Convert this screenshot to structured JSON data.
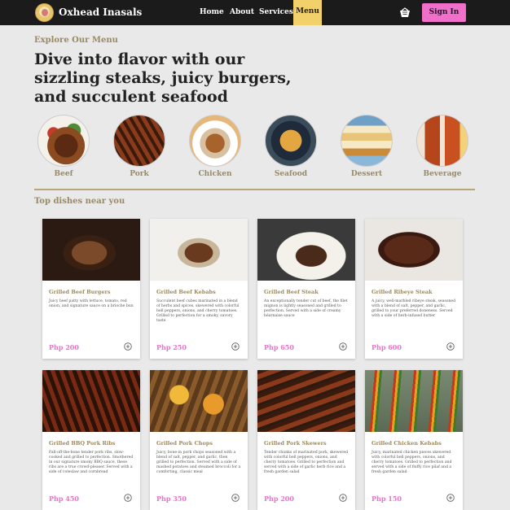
{
  "nav": {
    "brand": "Oxhead Inasals",
    "links": [
      "Home",
      "About",
      "Services",
      "Menu"
    ],
    "active": "Menu",
    "signin": "Sign In",
    "icons": [
      "logo",
      "basket-icon"
    ],
    "colors": {
      "bar": "#1b1b1b",
      "active": "#f2d16b",
      "signin": "#f06fc9"
    }
  },
  "hero": {
    "eyebrow": "Explore Our Menu",
    "headline": "Dive into flavor with our sizzling steaks, juicy burgers, and succulent seafood"
  },
  "categories": [
    {
      "label": "Beef"
    },
    {
      "label": "Pork"
    },
    {
      "label": "Chicken"
    },
    {
      "label": "Seafood"
    },
    {
      "label": "Dessert"
    },
    {
      "label": "Beverage"
    }
  ],
  "section": {
    "title": "Top dishes near you"
  },
  "dishes": [
    {
      "title": "Grilled Beef Burgers",
      "desc": "Juicy beef patty with lettuce, tomato, red onion, and signature sauce on a brioche bun",
      "price": "Php 200"
    },
    {
      "title": "Grilled Beef Kebabs",
      "desc": "Succulent beef cubes marinated in a blend of herbs and spices, skewered with colorful bell peppers, onions, and cherry tomatoes. Grilled to perfection for a smoky, savory taste",
      "price": "Php 250"
    },
    {
      "title": "Grilled Beef Steak",
      "desc": "An exceptionally tender cut of beef, the filet mignon is lightly seasoned and grilled to perfection. Served with a side of creamy béarnaise sauce",
      "price": "Php 650"
    },
    {
      "title": "Grilled Ribeye Steak",
      "desc": "A juicy, well-marbled ribeye steak, seasoned with a blend of salt, pepper, and garlic, grilled to your preferred doneness. Served with a side of herb-infused butter",
      "price": "Php 600"
    },
    {
      "title": "Grilled BBQ Pork Ribs",
      "desc": "Fall-off-the-bone tender pork ribs, slow-cooked and grilled to perfection. Smothered in our signature smoky BBQ sauce, these ribs are a true crowd-pleaser. Served with a side of coleslaw and cornbread",
      "price": "Php 450"
    },
    {
      "title": "Grilled Pork Chops",
      "desc": "Juicy, bone-in pork chops seasoned with a blend of salt, pepper, and garlic, then grilled to perfection. Served with a side of mashed potatoes and steamed broccoli for a comforting, classic meal",
      "price": "Php 350"
    },
    {
      "title": "Grilled Pork Skewers",
      "desc": "Tender chunks of marinated pork, skewered with colorful bell peppers, onions, and cherry tomatoes. Grilled to perfection and served with a side of garlic herb rice and a fresh garden salad",
      "price": "Php 200"
    },
    {
      "title": "Grilled Chicken Kebabs",
      "desc": "Juicy, marinated chicken pieces skewered with colorful bell peppers, onions, and cherry tomatoes. Grilled to perfection and served with a side of fluffy rice pilaf and a fresh garden salad",
      "price": "Php 150"
    }
  ]
}
